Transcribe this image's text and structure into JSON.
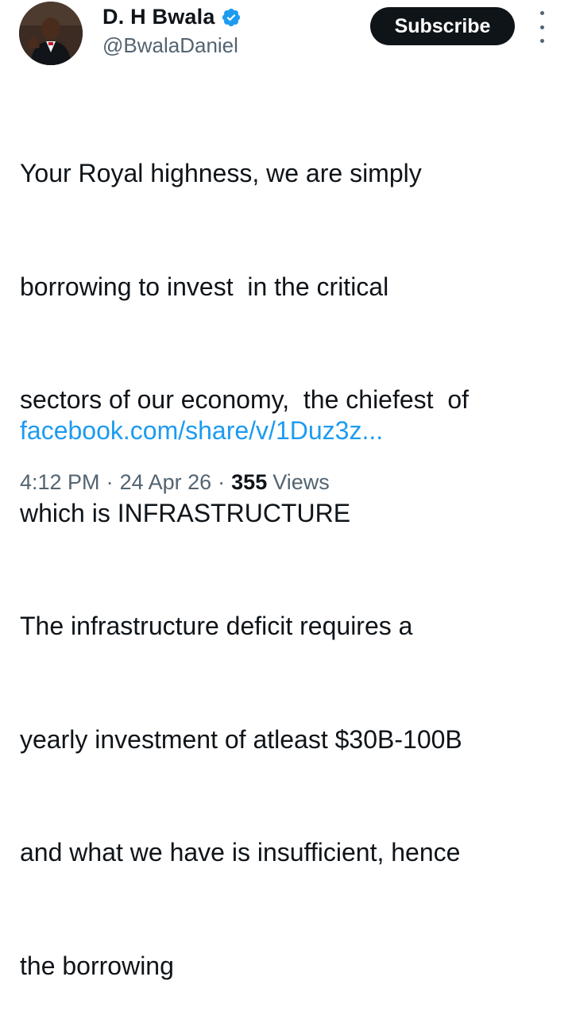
{
  "author": {
    "name": "D. H Bwala",
    "handle": "@BwalaDaniel"
  },
  "actions": {
    "subscribe_label": "Subscribe"
  },
  "tweet": {
    "lines": [
      "Your Royal highness, we are simply",
      "borrowing to invest  in the critical",
      "sectors of our economy,  the chiefest  of",
      "which is INFRASTRUCTURE",
      "The infrastructure deficit requires a",
      "yearly investment of atleast $30B-100B",
      "and what we have is insufficient, hence",
      "the borrowing"
    ],
    "link": "facebook.com/share/v/1Duz3z..."
  },
  "meta": {
    "time": "4:12 PM",
    "date": "24 Apr 26",
    "separator": "·",
    "views_count": "355",
    "views_label": "Views"
  },
  "colors": {
    "link": "#1d9bf0",
    "verified_badge": "#1d9bf0",
    "subscribe_bg": "#0f1419",
    "secondary_text": "#536471"
  },
  "icons": {
    "verified": "verified-badge-icon",
    "more": "more-options-icon"
  }
}
